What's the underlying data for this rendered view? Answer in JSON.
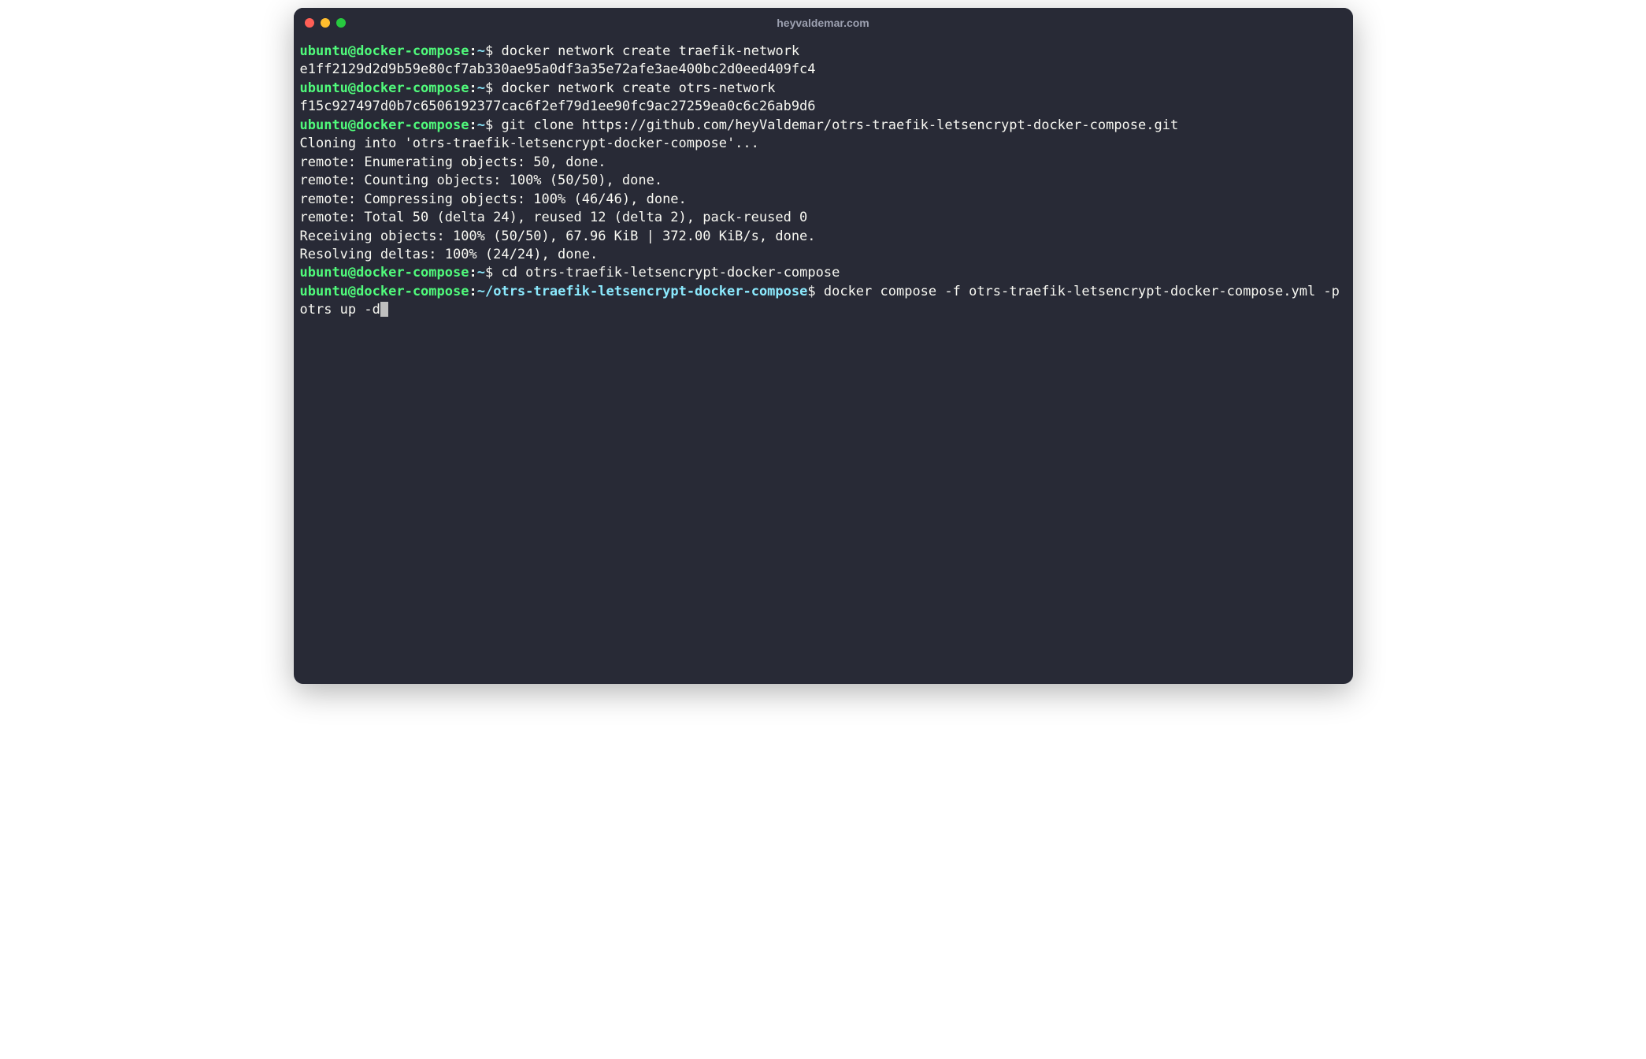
{
  "titlebar": {
    "title": "heyvaldemar.com"
  },
  "prompts": [
    {
      "user": "ubuntu",
      "host": "docker-compose",
      "path": "~",
      "command": "docker network create traefik-network"
    },
    {
      "user": "ubuntu",
      "host": "docker-compose",
      "path": "~",
      "command": "docker network create otrs-network"
    },
    {
      "user": "ubuntu",
      "host": "docker-compose",
      "path": "~",
      "command": "git clone https://github.com/heyValdemar/otrs-traefik-letsencrypt-docker-compose.git"
    },
    {
      "user": "ubuntu",
      "host": "docker-compose",
      "path": "~",
      "command": "cd otrs-traefik-letsencrypt-docker-compose"
    },
    {
      "user": "ubuntu",
      "host": "docker-compose",
      "path": "~/otrs-traefik-letsencrypt-docker-compose",
      "command": "docker compose -f otrs-traefik-letsencrypt-docker-compose.yml -p otrs up -d"
    }
  ],
  "outputs": {
    "net1": "e1ff2129d2d9b59e80cf7ab330ae95a0df3a35e72afe3ae400bc2d0eed409fc4",
    "net2": "f15c927497d0b7c6506192377cac6f2ef79d1ee90fc9ac27259ea0c6c26ab9d6",
    "clone1": "Cloning into 'otrs-traefik-letsencrypt-docker-compose'...",
    "clone2": "remote: Enumerating objects: 50, done.",
    "clone3": "remote: Counting objects: 100% (50/50), done.",
    "clone4": "remote: Compressing objects: 100% (46/46), done.",
    "clone5": "remote: Total 50 (delta 24), reused 12 (delta 2), pack-reused 0",
    "clone6": "Receiving objects: 100% (50/50), 67.96 KiB | 372.00 KiB/s, done.",
    "clone7": "Resolving deltas: 100% (24/24), done."
  },
  "symbols": {
    "at": "@",
    "colon": ":",
    "dollar": "$"
  }
}
